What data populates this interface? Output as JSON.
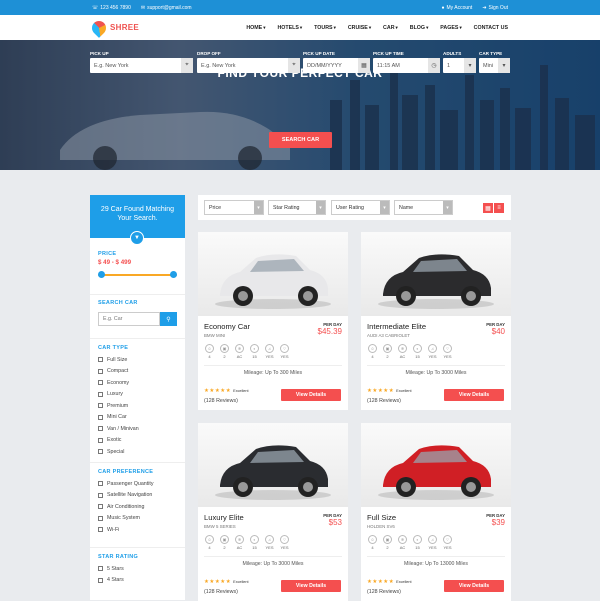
{
  "topbar": {
    "phone": "123 456 7890",
    "email": "support@gmail.com",
    "account": "My Account",
    "signout": "Sign Out"
  },
  "brand": {
    "name": "SHREE"
  },
  "nav": {
    "items": [
      "HOME",
      "HOTELS",
      "TOURS",
      "CRUISE",
      "CAR",
      "BLOG",
      "PAGES",
      "CONTACT US"
    ],
    "dropdown_marker": "▾"
  },
  "hero": {
    "title": "FIND YOUR PERFECT CAR"
  },
  "search_form": {
    "pickup_label": "PICK UP",
    "pickup_placeholder": "E.g. New York",
    "dropoff_label": "DROP OFF",
    "dropoff_placeholder": "E.g. New York",
    "date_label": "PICK UP DATE",
    "date_placeholder": "DD/MM/YYYY",
    "time_label": "PICK UP TIME",
    "time_value": "11:15 AM",
    "adults_label": "ADULTS",
    "adults_value": "1",
    "cartype_label": "CAR TYPE",
    "cartype_value": "Mini",
    "submit": "SEARCH CAR"
  },
  "sidebar": {
    "found_text": "29 Car Found Matching Your Search.",
    "price_title": "PRICE",
    "price_range": "$ 49 - $ 499",
    "price_low_fraction": 0.0,
    "price_high_fraction": 1.0,
    "search_title": "SEARCH CAR",
    "search_placeholder": "E.g. Car",
    "cartype_title": "CAR TYPE",
    "cartypes": [
      "Full Size",
      "Compact",
      "Economy",
      "Luxury",
      "Premium",
      "Mini Car",
      "Van / Minivan",
      "Exotic",
      "Special"
    ],
    "pref_title": "CAR PREFERENCE",
    "prefs": [
      "Passenger Quantity",
      "Satellite Navigation",
      "Air Conditioning",
      "Music System",
      "Wi-Fi"
    ],
    "rating_title": "STAR RATING",
    "ratings": [
      "5 Stars",
      "4 Stars"
    ]
  },
  "toolbar": {
    "price": "Price",
    "star": "Star Rating",
    "user": "User Rating",
    "name": "Name"
  },
  "colors": {
    "primary": "#1e9ee8",
    "accent": "#f44f4f",
    "star": "#f9a825"
  },
  "cars": [
    {
      "name": "Economy Car",
      "model": "BMW MINI",
      "per_day": "PER DAY",
      "price": "$45.39",
      "mileage": "Mileage: Up To 300 Miles",
      "rating_text": "Excellent",
      "reviews": "(128 Reviews)",
      "button": "View Details",
      "color": "#e8e8ea",
      "features": [
        "4",
        "2",
        "AC",
        "15",
        "YES",
        "YES"
      ]
    },
    {
      "name": "Intermediate Elite",
      "model": "AUDI A3 CABRIOLET",
      "per_day": "PER DAY",
      "price": "$40",
      "mileage": "Mileage: Up To 3000 Miles",
      "rating_text": "Excellent",
      "reviews": "(128 Reviews)",
      "button": "View Details",
      "color": "#2b2b2d",
      "features": [
        "4",
        "2",
        "AC",
        "15",
        "YES",
        "YES"
      ]
    },
    {
      "name": "Luxury Elite",
      "model": "BMW 5 SERIES",
      "per_day": "PER DAY",
      "price": "$53",
      "mileage": "Mileage: Up To 3000 Miles",
      "rating_text": "Excellent",
      "reviews": "(128 Reviews)",
      "button": "View Details",
      "color": "#2a2c30",
      "features": [
        "4",
        "2",
        "AC",
        "15",
        "YES",
        "YES"
      ]
    },
    {
      "name": "Full Size",
      "model": "HOLDEN SV6",
      "per_day": "PER DAY",
      "price": "$39",
      "mileage": "Mileage: Up To 13000 Miles",
      "rating_text": "Excellent",
      "reviews": "(128 Reviews)",
      "button": "View Details",
      "color": "#d01f25",
      "features": [
        "4",
        "2",
        "AC",
        "15",
        "YES",
        "YES"
      ]
    }
  ]
}
